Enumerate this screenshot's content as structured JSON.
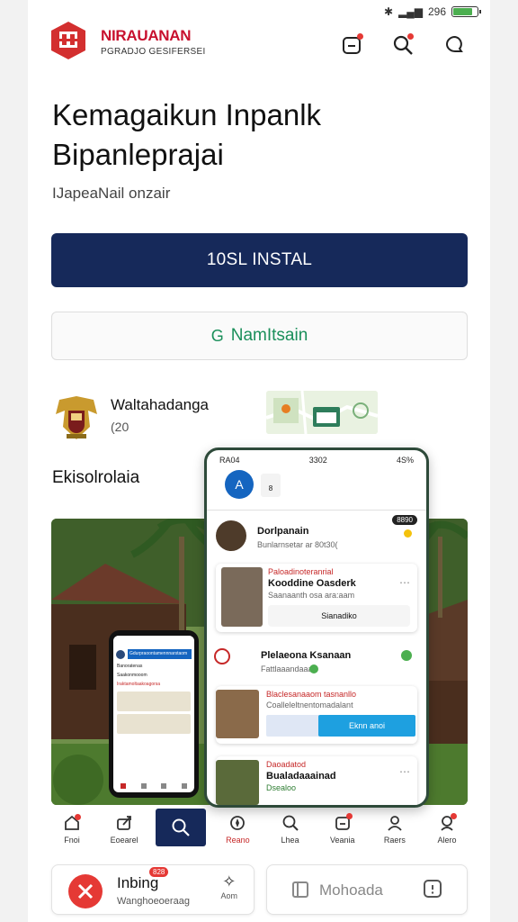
{
  "status_bar": {
    "time": "296",
    "battery_level": 0.8
  },
  "header": {
    "brand_title": "NIRAUANAN",
    "brand_subtitle": "PGRADJO GESIFERSEI",
    "icons": [
      "notification-box-icon",
      "search-icon",
      "chat-icon"
    ]
  },
  "hero": {
    "headline_line1": "Kemagaikun Inpanlk",
    "headline_line2": "Bipanleprajai",
    "subtitle": "IJapeaNail onzair"
  },
  "buttons": {
    "primary_label": "10SL INSTAL",
    "secondary_label": "NamItsain",
    "secondary_icon": "G"
  },
  "org": {
    "name": "Waltahadanga",
    "meta": "(20"
  },
  "section": {
    "label": "Ekisolrolaia"
  },
  "mockup": {
    "status_left": "RA04",
    "status_mid": "3302",
    "status_right": "4S%",
    "app_badge": "A",
    "app_badge_sub": "8",
    "post1_title": "Dorlpanain",
    "post1_sub": "Bunlarnsetar ar 80t30(",
    "post1_tag": "8890",
    "card1_tag": "Paloadinoteranrial",
    "card1_title": "Kooddine Oasderk",
    "card1_sub": "Saanaanth osa ara:aam",
    "card1_button": "Sianadiko",
    "post2_title": "Plelaeona Ksanaan",
    "post2_sub": "Fattlaaandaaar",
    "card2_tag": "Blaclesanaaom tasnanllo",
    "card2_sub": "Coalleleltnentomadalant",
    "card2_button": "Eknn anoi",
    "card3_tag": "Daoadatod",
    "card3_title": "Bualadaaainad",
    "card3_sub": "Dsealoo"
  },
  "small_phone": {
    "tab": "Gdurpraoontamennnarstaom",
    "row1": "Banoratenas",
    "row2": "Saakonmooom",
    "row3": "Iraktamoltaakoagorsa"
  },
  "bottom_nav": [
    {
      "label": "Fnoi",
      "icon": "home-icon"
    },
    {
      "label": "Eoearel",
      "icon": "share-icon"
    },
    {
      "label": "",
      "icon": "search-icon"
    },
    {
      "label": "Reano",
      "icon": "location-icon"
    },
    {
      "label": "Lhea",
      "icon": "search-icon"
    },
    {
      "label": "Veania",
      "icon": "notification-icon"
    },
    {
      "label": "Raers",
      "icon": "user-icon"
    },
    {
      "label": "Alero",
      "icon": "profile-icon"
    }
  ],
  "bottom_cards": {
    "left_title": "Inbing",
    "left_badge": "828",
    "left_sub": "Wanghoeoeraag",
    "left_action": "Aom",
    "right_label": "Mohoada"
  },
  "colors": {
    "primary": "#16295a",
    "accent_red": "#c8102e",
    "accent_green": "#1a8f5a"
  }
}
